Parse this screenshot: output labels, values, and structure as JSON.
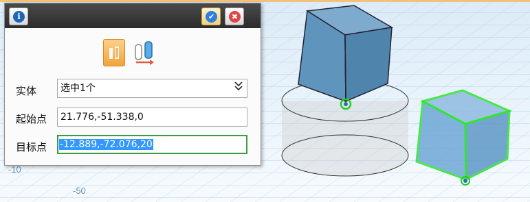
{
  "dialog": {
    "fields": {
      "entity_label": "实体",
      "entity_value": "选中1个",
      "start_label": "起始点",
      "start_value": "21.776,-51.338,0",
      "target_label": "目标点",
      "target_value": "-12.889,-72.076,20"
    },
    "icons": {
      "info": "info-icon",
      "confirm": "check-icon",
      "cancel": "close-icon",
      "mode_single": "single-move-icon",
      "mode_multi": "copy-move-icon",
      "expand": "double-chevron-down-icon"
    },
    "colors": {
      "selected_mode": "#f2a33a",
      "active_field_border": "#3d9a45",
      "text_highlight": "#3399ff"
    }
  },
  "viewport": {
    "axis_labels": [
      "-50",
      "-10"
    ],
    "colors": {
      "cube_fill": "#5f95bd",
      "selected_outline": "#2ee52e",
      "grid": "#8fc0e0"
    }
  }
}
